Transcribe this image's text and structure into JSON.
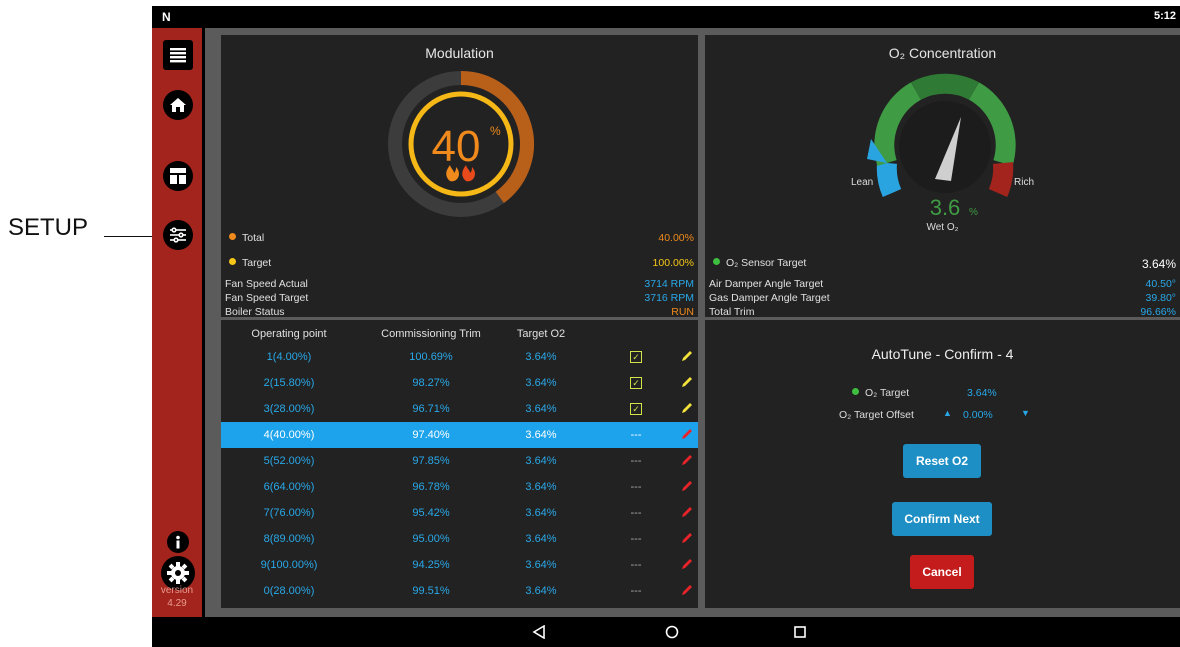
{
  "annotation": {
    "label": "SETUP"
  },
  "status_bar": {
    "logo": "N",
    "time": "5:12"
  },
  "sidebar": {
    "icons": [
      "menu-icon",
      "home-icon",
      "dashboard-icon",
      "setup-sliders-icon",
      "info-icon",
      "settings-gear-icon"
    ],
    "version_label": "version",
    "version_number": "4.29"
  },
  "modulation": {
    "title": "Modulation",
    "gauge_value": "40",
    "gauge_unit": "%",
    "gauge_fraction": 0.4,
    "target_fraction": 1.0,
    "rows": [
      {
        "label": "Total",
        "value": "40.00%"
      },
      {
        "label": "Target",
        "value": "100.00%"
      },
      {
        "label": "Fan Speed Actual",
        "value": "3714 RPM"
      },
      {
        "label": "Fan Speed Target",
        "value": "3716 RPM"
      },
      {
        "label": "Boiler Status",
        "value": "RUN"
      }
    ]
  },
  "o2": {
    "title": "O₂ Concentration",
    "gauge_value": "3.6",
    "gauge_unit": "%",
    "lean_label": "Lean",
    "rich_label": "Rich",
    "wet_label": "Wet O₂",
    "rows": [
      {
        "label": "O₂ Sensor Target",
        "value": "3.64%"
      },
      {
        "label": "Air Damper Angle Target",
        "value": "40.50°"
      },
      {
        "label": "Gas Damper Angle Target",
        "value": "39.80°"
      },
      {
        "label": "Total Trim",
        "value": "96.66%"
      }
    ]
  },
  "table": {
    "headers": [
      "Operating point",
      "Commissioning Trim",
      "Target O2"
    ],
    "rows": [
      {
        "point": "1(4.00%)",
        "trim": "100.69%",
        "target": "3.64%",
        "status": "check"
      },
      {
        "point": "2(15.80%)",
        "trim": "98.27%",
        "target": "3.64%",
        "status": "check"
      },
      {
        "point": "3(28.00%)",
        "trim": "96.71%",
        "target": "3.64%",
        "status": "check"
      },
      {
        "point": "4(40.00%)",
        "trim": "97.40%",
        "target": "3.64%",
        "status": "---"
      },
      {
        "point": "5(52.00%)",
        "trim": "97.85%",
        "target": "3.64%",
        "status": "---"
      },
      {
        "point": "6(64.00%)",
        "trim": "96.78%",
        "target": "3.64%",
        "status": "---"
      },
      {
        "point": "7(76.00%)",
        "trim": "95.42%",
        "target": "3.64%",
        "status": "---"
      },
      {
        "point": "8(89.00%)",
        "trim": "95.00%",
        "target": "3.64%",
        "status": "---"
      },
      {
        "point": "9(100.00%)",
        "trim": "94.25%",
        "target": "3.64%",
        "status": "---"
      },
      {
        "point": "0(28.00%)",
        "trim": "99.51%",
        "target": "3.64%",
        "status": "---"
      }
    ],
    "selected_index": 3
  },
  "autotune": {
    "title": "AutoTune - Confirm - 4",
    "o2_target_label": "O₂ Target",
    "o2_target_value": "3.64%",
    "offset_label": "O₂ Target Offset",
    "offset_value": "0.00%",
    "reset_label": "Reset O2",
    "confirm_label": "Confirm Next",
    "cancel_label": "Cancel"
  },
  "colors": {
    "sidebar": "#a3241c",
    "accent_blue": "#29a8e8",
    "accent_orange": "#f08a1c",
    "accent_yellow": "#f5c518",
    "selected_row": "#1ca3ec",
    "button_blue": "#1e8fc4",
    "button_red": "#c41c1c"
  }
}
